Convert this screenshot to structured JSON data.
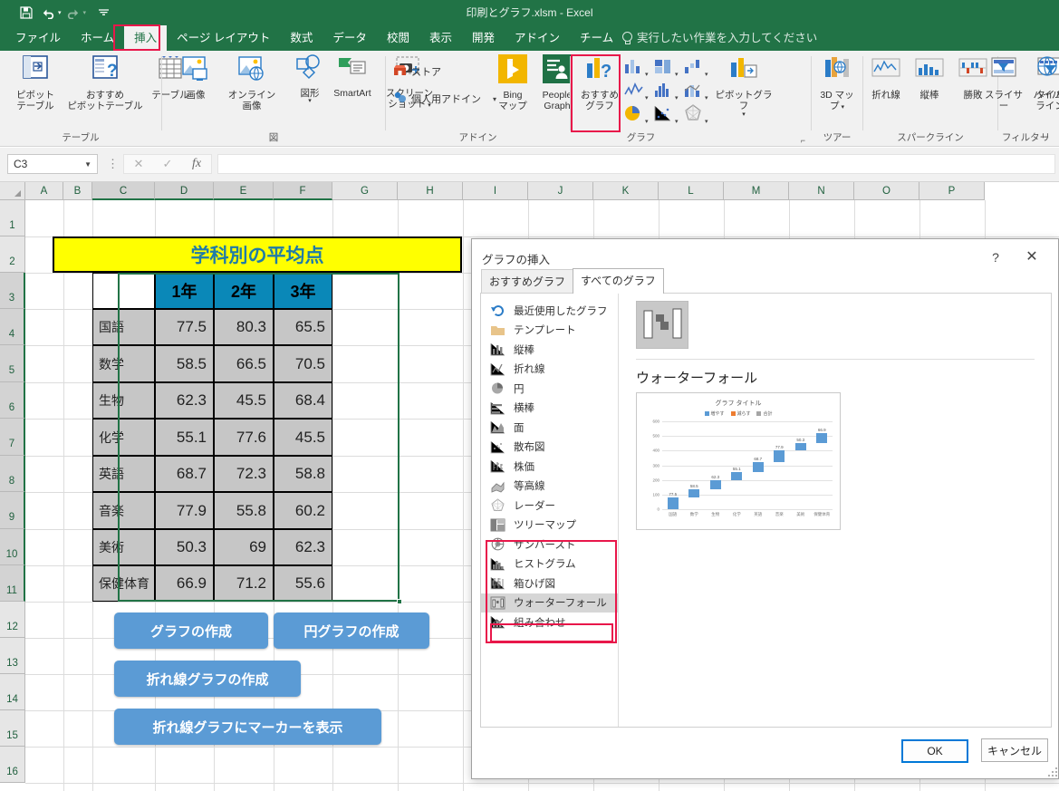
{
  "titlebar": {
    "document_title": "印刷とグラフ.xlsm - Excel",
    "qat": [
      {
        "name": "save-icon",
        "glyph": "💾"
      },
      {
        "name": "undo-icon",
        "glyph": "↶"
      },
      {
        "name": "redo-icon",
        "glyph": "↷"
      },
      {
        "name": "customize-quick-access-toolbar-icon",
        "glyph": "☰"
      }
    ]
  },
  "ribbon": {
    "tabs": [
      {
        "label": "ファイル",
        "active": false
      },
      {
        "label": "ホーム",
        "active": false
      },
      {
        "label": "挿入",
        "active": true
      },
      {
        "label": "ページ レイアウト",
        "active": false
      },
      {
        "label": "数式",
        "active": false
      },
      {
        "label": "データ",
        "active": false
      },
      {
        "label": "校閲",
        "active": false
      },
      {
        "label": "表示",
        "active": false
      },
      {
        "label": "開発",
        "active": false
      },
      {
        "label": "アドイン",
        "active": false
      },
      {
        "label": "チーム",
        "active": false
      }
    ],
    "tell_me": "実行したい作業を入力してください",
    "groups": [
      {
        "label": "テーブル"
      },
      {
        "label": "図"
      },
      {
        "label": "アドイン"
      },
      {
        "label": "グラフ"
      },
      {
        "label": "ツアー"
      },
      {
        "label": "スパークライン"
      },
      {
        "label": "フィルター"
      },
      {
        "label": "リ"
      }
    ],
    "buttons": {
      "pivot_table": "ピボット\nテーブル",
      "pivot_table_l1": "ピボット",
      "pivot_table_l2": "テーブル",
      "recommended_pivot_l1": "おすすめ",
      "recommended_pivot_l2": "ピボットテーブル",
      "table": "テーブル",
      "picture": "画像",
      "online_picture_l1": "オンライン",
      "online_picture_l2": "画像",
      "shapes": "図形",
      "smartart": "SmartArt",
      "screenshot_l1": "スクリーン",
      "screenshot_l2": "ショット",
      "store": "ストア",
      "my_addins": "個人用アドイン",
      "bing_maps_l1": "Bing",
      "bing_maps_l2": "マップ",
      "people_graph_l1": "People",
      "people_graph_l2": "Graph",
      "recommended_charts_l1": "おすすめ",
      "recommended_charts_l2": "グラフ",
      "pivot_chart": "ピボットグラフ",
      "map_3d_l1": "3D マッ",
      "map_3d_l2": "プ",
      "line_sparkline": "折れ線",
      "column_sparkline": "縦棒",
      "winloss_sparkline": "勝敗",
      "slicer": "スライサー",
      "timeline_l1": "タイム",
      "timeline_l2": "ライン",
      "hyperlink": "ハイパ"
    }
  },
  "formula_bar": {
    "name_box_value": "C3",
    "cancel_icon": "✕",
    "enter_icon": "✓",
    "function_icon": "fx",
    "formula_value": ""
  },
  "sheet": {
    "columns": [
      "A",
      "B",
      "C",
      "D",
      "E",
      "F",
      "G",
      "H",
      "I",
      "J",
      "K",
      "L",
      "M",
      "N",
      "O",
      "P"
    ],
    "selected_columns": [
      "C",
      "D",
      "E",
      "F"
    ],
    "rows": [
      "1",
      "2",
      "3",
      "4",
      "5",
      "6",
      "7",
      "8",
      "9",
      "10",
      "11",
      "12",
      "13",
      "14",
      "15",
      "16"
    ],
    "selected_rows": [
      "3",
      "4",
      "5",
      "6",
      "7",
      "8",
      "9",
      "10",
      "11"
    ],
    "title_cell": "学科別の平均点",
    "table_headers": [
      "",
      "1年",
      "2年",
      "3年"
    ],
    "table_rows": [
      {
        "subject": "国語",
        "values": [
          "77.5",
          "80.3",
          "65.5"
        ]
      },
      {
        "subject": "数学",
        "values": [
          "58.5",
          "66.5",
          "70.5"
        ]
      },
      {
        "subject": "生物",
        "values": [
          "62.3",
          "45.5",
          "68.4"
        ]
      },
      {
        "subject": "化学",
        "values": [
          "55.1",
          "77.6",
          "45.5"
        ]
      },
      {
        "subject": "英語",
        "values": [
          "68.7",
          "72.3",
          "58.8"
        ]
      },
      {
        "subject": "音楽",
        "values": [
          "77.9",
          "55.8",
          "60.2"
        ]
      },
      {
        "subject": "美術",
        "values": [
          "50.3",
          "69",
          "62.3"
        ]
      },
      {
        "subject": "保健体育",
        "values": [
          "66.9",
          "71.2",
          "55.6"
        ]
      }
    ],
    "form_buttons": [
      {
        "label": "グラフの作成"
      },
      {
        "label": "円グラフの作成"
      },
      {
        "label": "折れ線グラフの作成"
      },
      {
        "label": "折れ線グラフにマーカーを表示"
      }
    ]
  },
  "dialog": {
    "title": "グラフの挿入",
    "help_icon": "?",
    "close_icon": "✕",
    "tabs": [
      {
        "label": "おすすめグラフ",
        "active": false
      },
      {
        "label": "すべてのグラフ",
        "active": true
      }
    ],
    "chart_types": [
      {
        "label": "最近使用したグラフ",
        "icon": "recent-charts-icon",
        "selected": false
      },
      {
        "label": "テンプレート",
        "icon": "templates-folder-icon",
        "selected": false
      },
      {
        "label": "縦棒",
        "icon": "column-chart-icon",
        "selected": false
      },
      {
        "label": "折れ線",
        "icon": "line-chart-icon",
        "selected": false
      },
      {
        "label": "円",
        "icon": "pie-chart-icon",
        "selected": false
      },
      {
        "label": "横棒",
        "icon": "bar-chart-icon",
        "selected": false
      },
      {
        "label": "面",
        "icon": "area-chart-icon",
        "selected": false
      },
      {
        "label": "散布図",
        "icon": "scatter-chart-icon",
        "selected": false
      },
      {
        "label": "株価",
        "icon": "stock-chart-icon",
        "selected": false
      },
      {
        "label": "等高線",
        "icon": "surface-chart-icon",
        "selected": false
      },
      {
        "label": "レーダー",
        "icon": "radar-chart-icon",
        "selected": false
      },
      {
        "label": "ツリーマップ",
        "icon": "treemap-chart-icon",
        "selected": false
      },
      {
        "label": "サンバースト",
        "icon": "sunburst-chart-icon",
        "selected": false
      },
      {
        "label": "ヒストグラム",
        "icon": "histogram-chart-icon",
        "selected": false
      },
      {
        "label": "箱ひげ図",
        "icon": "boxwhisker-chart-icon",
        "selected": false
      },
      {
        "label": "ウォーターフォール",
        "icon": "waterfall-chart-icon",
        "selected": true
      },
      {
        "label": "組み合わせ",
        "icon": "combo-chart-icon",
        "selected": false
      }
    ],
    "preview_title": "ウォーターフォール",
    "ok_label": "OK",
    "cancel_label": "キャンセル"
  },
  "chart_data": {
    "type": "bar",
    "title": "グラフ タイトル",
    "legend": [
      {
        "label": "増やす",
        "color": "#5b9bd5"
      },
      {
        "label": "減らす",
        "color": "#ed7d31"
      },
      {
        "label": "合計",
        "color": "#a5a5a5"
      }
    ],
    "legend_position": "top",
    "categories": [
      "国語",
      "数学",
      "生物",
      "化学",
      "英語",
      "音楽",
      "美術",
      "保健体育"
    ],
    "values": [
      77.5,
      58.5,
      62.3,
      55.1,
      68.7,
      77.9,
      50.3,
      66.9
    ],
    "cumulative": [
      77.5,
      136.0,
      198.3,
      253.4,
      322.1,
      400.0,
      450.3,
      517.2
    ],
    "yticks": [
      "0",
      "100",
      "200",
      "300",
      "400",
      "500",
      "600"
    ],
    "ylim": [
      0,
      600
    ],
    "xlabel": "",
    "ylabel": "",
    "grid": true
  }
}
